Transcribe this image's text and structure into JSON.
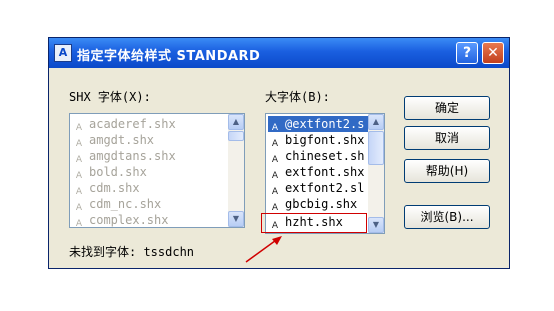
{
  "dialog": {
    "title": "指定字体给样式 STANDARD",
    "app_icon": "A",
    "help_glyph": "?",
    "close_glyph": "✕"
  },
  "shx_font": {
    "label": "SHX 字体(X):",
    "items": [
      "acaderef.shx",
      "amgdt.shx",
      "amgdtans.shx",
      "bold.shx",
      "cdm.shx",
      "cdm_nc.shx",
      "complex.shx"
    ]
  },
  "big_font": {
    "label": "大字体(B):",
    "items": [
      "@extfont2.s",
      "bigfont.shx",
      "chineset.sh",
      "extfont.shx",
      "extfont2.sl",
      "gbcbig.shx",
      "hzht.shx"
    ],
    "selected_index": 0,
    "highlighted_item": "hzht.shx"
  },
  "buttons": {
    "ok": "确定",
    "cancel": "取消",
    "help": "帮助(H)",
    "browse": "浏览(B)..."
  },
  "status": {
    "missing_font": "未找到字体: tssdchn"
  },
  "icons": {
    "font_item": "shx-font-icon",
    "scroll_up": "scroll-up-arrow-icon",
    "scroll_down": "scroll-down-arrow-icon"
  },
  "colors": {
    "title_bar": "#0b49c9",
    "dialog_bg": "#ece9d8",
    "selection": "#316ac5",
    "annotation": "#d00000"
  }
}
